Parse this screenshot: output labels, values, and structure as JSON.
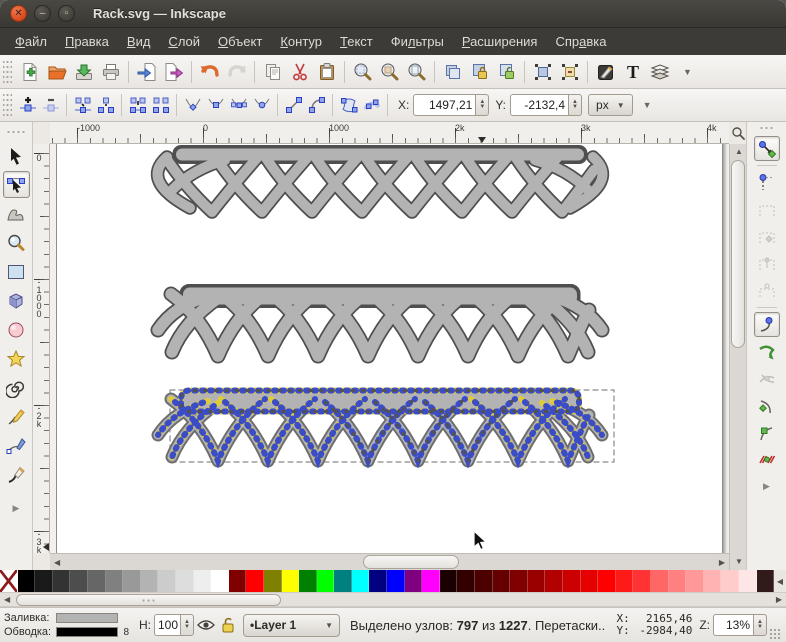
{
  "window": {
    "title": "Rack.svg — Inkscape"
  },
  "menu": {
    "items": [
      {
        "pre": "",
        "u": "Ф",
        "post": "айл"
      },
      {
        "pre": "",
        "u": "П",
        "post": "равка"
      },
      {
        "pre": "",
        "u": "В",
        "post": "ид"
      },
      {
        "pre": "",
        "u": "С",
        "post": "лой"
      },
      {
        "pre": "",
        "u": "О",
        "post": "бъект"
      },
      {
        "pre": "",
        "u": "К",
        "post": "онтур"
      },
      {
        "pre": "",
        "u": "Т",
        "post": "екст"
      },
      {
        "pre": "Фи",
        "u": "л",
        "post": "ьтры"
      },
      {
        "pre": "",
        "u": "Р",
        "post": "асширения"
      },
      {
        "pre": "Спр",
        "u": "а",
        "post": "вка"
      }
    ]
  },
  "toolbar_main": {
    "buttons": [
      "document-new",
      "document-open",
      "document-save",
      "print",
      "import",
      "export",
      "undo",
      "redo",
      "copy",
      "cut",
      "paste",
      "zoom-selection",
      "zoom-drawing",
      "zoom-page",
      "duplicate",
      "create-clone",
      "unlink-clone",
      "group",
      "ungroup",
      "fill-stroke-dialog",
      "text-dialog",
      "layers-dialog",
      "toolbar-overflow"
    ]
  },
  "toolbar_node": {
    "buttons": [
      "insert-node",
      "delete-node",
      "join-nodes",
      "break-nodes",
      "join-with-segment",
      "delete-segment",
      "node-corner",
      "node-smooth",
      "node-symmetric",
      "node-auto",
      "segment-line",
      "segment-curve",
      "object-to-path",
      "stroke-to-path"
    ],
    "x_label": "X:",
    "x_value": "1497,21",
    "y_label": "Y:",
    "y_value": "-2132,4",
    "unit": "px"
  },
  "rulers": {
    "horizontal_labels": [
      {
        "text": "-1000",
        "pos": 27
      },
      {
        "text": "0",
        "pos": 153
      },
      {
        "text": "1000",
        "pos": 279
      },
      {
        "text": "2k",
        "pos": 405
      },
      {
        "text": "3k",
        "pos": 531
      },
      {
        "text": "4k",
        "pos": 657
      }
    ],
    "vertical_labels": [
      {
        "text": "0",
        "pos": 9
      },
      {
        "text": "-1000",
        "pos": 133
      },
      {
        "text": "-2k",
        "pos": 259
      },
      {
        "text": "-3k",
        "pos": 385
      }
    ]
  },
  "toolbox": {
    "tools": [
      "selector",
      "node-editor",
      "tweak",
      "zoom",
      "rectangle",
      "box-3d",
      "ellipse",
      "star",
      "spiral",
      "pencil",
      "bezier-pen",
      "calligraphy"
    ]
  },
  "snapbar": {
    "buttons": [
      "snap-enable",
      "snap-bounding-box",
      "snap-bbox-edges",
      "snap-bbox-corners",
      "snap-bbox-edge-midpoints",
      "snap-bbox-centers",
      "snap-nodes",
      "snap-to-paths",
      "snap-path-intersections",
      "snap-cusp-nodes",
      "snap-smooth-nodes",
      "snap-midpoints"
    ]
  },
  "palette": {
    "colors": [
      "none",
      "#000000",
      "#1a1a1a",
      "#333333",
      "#4d4d4d",
      "#666666",
      "#808080",
      "#999999",
      "#b3b3b3",
      "#cccccc",
      "#dddddd",
      "#eeeeee",
      "#ffffff",
      "#800000",
      "#ff0000",
      "#808000",
      "#ffff00",
      "#008000",
      "#00ff00",
      "#008080",
      "#00ffff",
      "#000080",
      "#0000ff",
      "#800080",
      "#ff00ff",
      "#1a0000",
      "#330000",
      "#4d0000",
      "#660000",
      "#800000",
      "#990000",
      "#b30000",
      "#cc0000",
      "#e60000",
      "#ff0000",
      "#ff1a1a",
      "#ff3333",
      "#ff6666",
      "#ff8080",
      "#ff9999",
      "#ffb3b3",
      "#ffcccc",
      "#ffe6e6",
      "#331a1a"
    ]
  },
  "statusbar": {
    "fill_label": "Заливка:",
    "stroke_label": "Обводка:",
    "fill_color": "#b3b3b3",
    "stroke_color": "#000000",
    "stroke_width": "8",
    "opacity_label": "Н:",
    "opacity_value": "100",
    "layer_name": "•Layer 1",
    "status": {
      "prefix": "Выделено узлов: ",
      "selected": "797",
      "mid": " из ",
      "total": "1227",
      "suffix": ". Перетаски.."
    },
    "x_label": "X:",
    "x_value": "2165,46",
    "y_label": "Y:",
    "y_value": "-2984,40",
    "zoom_label": "Z:",
    "zoom_value": "13%"
  }
}
